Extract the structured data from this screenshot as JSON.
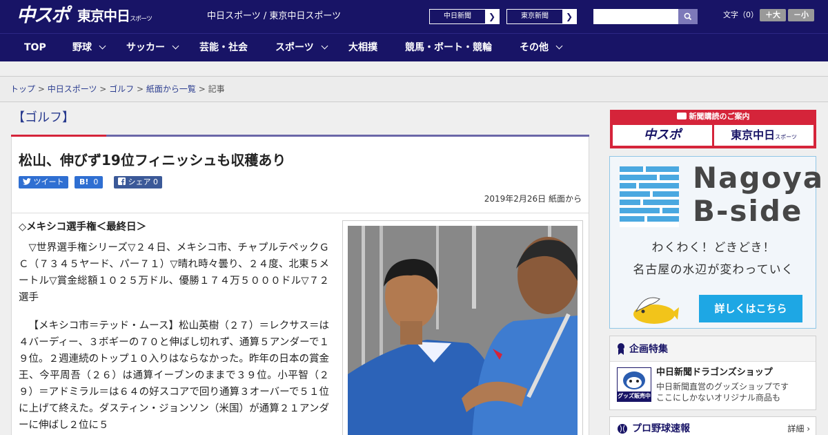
{
  "header": {
    "logo_main": "中スポ",
    "logo_tokyo": "東京中日",
    "logo_tokyo_sub": "スポーツ",
    "tagline": "中日スポーツ / 東京中日スポーツ",
    "sites": [
      {
        "label": "中日新聞"
      },
      {
        "label": "東京新聞"
      }
    ],
    "search": {
      "placeholder": "",
      "value": ""
    },
    "font_size": {
      "label": "文字（0）",
      "increase": "＋大",
      "decrease": "－小"
    }
  },
  "nav": {
    "items": [
      {
        "label": "TOP"
      },
      {
        "label": "野球"
      },
      {
        "label": "サッカー"
      },
      {
        "label": "芸能・社会"
      },
      {
        "label": "スポーツ"
      },
      {
        "label": "大相撲"
      },
      {
        "label": "競馬・ボート・競輪"
      },
      {
        "label": "その他"
      }
    ]
  },
  "breadcrumb": {
    "items": [
      "トップ",
      "中日スポーツ",
      "ゴルフ",
      "紙面から一覧"
    ],
    "current": "記事",
    "separator": " > "
  },
  "article": {
    "category": "【ゴルフ】",
    "headline": "松山、伸びず19位フィニッシュも収穫あり",
    "share": {
      "tweet": "ツイート",
      "hatena_count": "0",
      "facebook": "シェア",
      "facebook_count": "0"
    },
    "date": "2019年2月26日 紙面から",
    "lead": "◇メキシコ選手権＜最終日＞",
    "paragraphs": [
      "▽世界選手権シリーズ▽２４日、メキシコ市、チャプルテペックＧＣ（７３４５ヤード、パー７１）▽晴れ時々曇り、２４度、北東５メートル▽賞金総額１０２５万ドル、優勝１７４万５０００ドル▽７２選手",
      "【メキシコ市＝テッド・ムース】松山英樹（２７）＝レクサス＝は４バーディー、３ボギーの７０と伸ばし切れず、通算５アンダーで１９位。２週連続のトップ１０入りはならなかった。昨年の日本の賞金王、今平周吾（２６）は通算イーブンのままで３９位。小平智（２９）＝アドミラル＝は６４の好スコアで回り通算３オーバーで５１位に上げて終えた。ダスティン・ジョンソン（米国）が通算２１アンダーに伸ばし２位に５"
    ]
  },
  "sidebar": {
    "subscribe": {
      "title": "新聞購読のご案内",
      "logo1": "中スポ",
      "logo2": "東京中日",
      "logo2_sub": "スポーツ"
    },
    "bside": {
      "line1": "Nagoya",
      "line2": "B-side",
      "catch1": "わくわく！どきどき！",
      "catch2": "名古屋の水辺が変わっていく",
      "button": "詳しくはこちら"
    },
    "kikaku": {
      "title": "企画特集",
      "item_title": "中日新聞ドラゴンズショップ",
      "item_desc1": "中日新聞直営のグッズショップです",
      "item_desc2": "ここにしかないオリジナル商品も",
      "badge": "グッズ販売中"
    },
    "probaseball": {
      "title": "プロ野球速報",
      "more": "詳細 ›"
    }
  },
  "colors": {
    "navy": "#181466",
    "accent_red": "#d5243a",
    "tab_purple": "#6a66a8",
    "link": "#2a3c8f",
    "bside_blue": "#1ea7e4"
  }
}
